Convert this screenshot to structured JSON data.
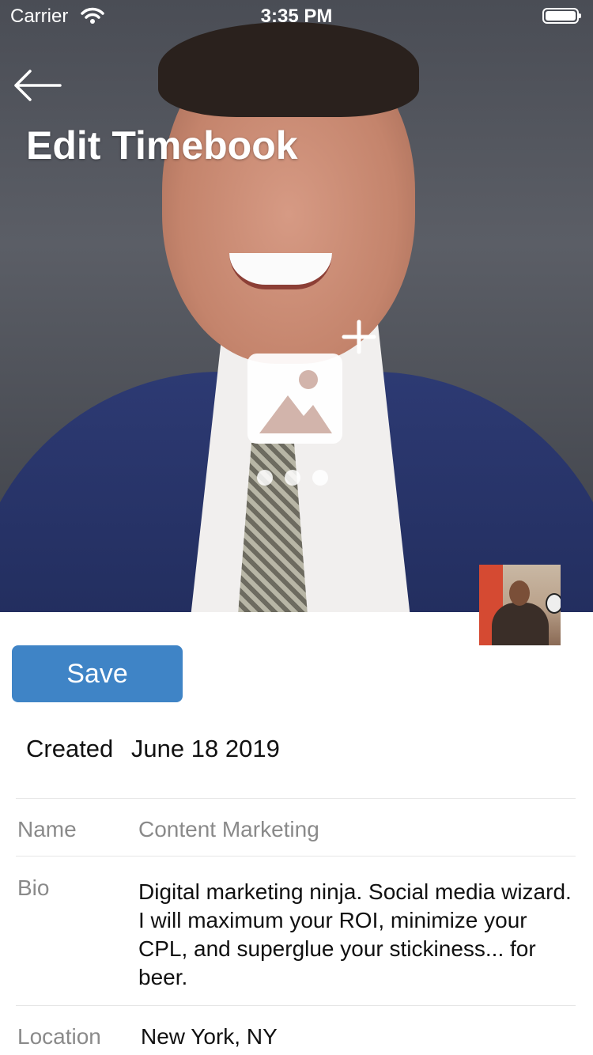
{
  "status_bar": {
    "carrier": "Carrier",
    "time": "3:35 PM"
  },
  "header": {
    "title": "Edit Timebook",
    "back_icon": "arrow-left-icon",
    "add_photo_icon": "add-image-icon"
  },
  "carousel": {
    "page_count": 3
  },
  "actions": {
    "save_label": "Save",
    "accent_color": "#3f84c6"
  },
  "created": {
    "label": "Created",
    "date": "June 18 2019"
  },
  "fields": {
    "name": {
      "label": "Name",
      "value": "Content Marketing"
    },
    "bio": {
      "label": "Bio",
      "value": "Digital marketing ninja. Social media wizard. I will maximum your ROI, minimize your CPL, and superglue your stickiness... for beer."
    },
    "location": {
      "label": "Location",
      "value": "New York, NY"
    }
  }
}
